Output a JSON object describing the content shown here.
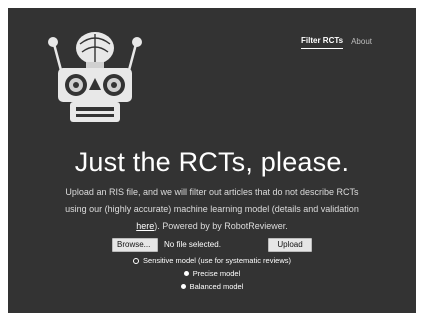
{
  "nav": {
    "filter_rcts": "Filter RCTs",
    "about": "About"
  },
  "hero": {
    "title": "Just the RCTs, please.",
    "desc_line1": "Upload an RIS file, and we will filter out articles that do not describe RCTs",
    "desc_line2": "using our (highly accurate) machine learning model (details and validation",
    "desc_link": "here",
    "desc_line3_rest": "). Powered by by RobotReviewer."
  },
  "form": {
    "browse_label": "Browse...",
    "file_status": "No file selected.",
    "upload_label": "Upload",
    "options": [
      "Sensitive model (use for systematic reviews)",
      "Precise model",
      "Balanced model"
    ]
  },
  "icons": {
    "logo": "robot-logo-icon"
  },
  "colors": {
    "panel_bg": "#333333",
    "text": "#ffffff"
  }
}
